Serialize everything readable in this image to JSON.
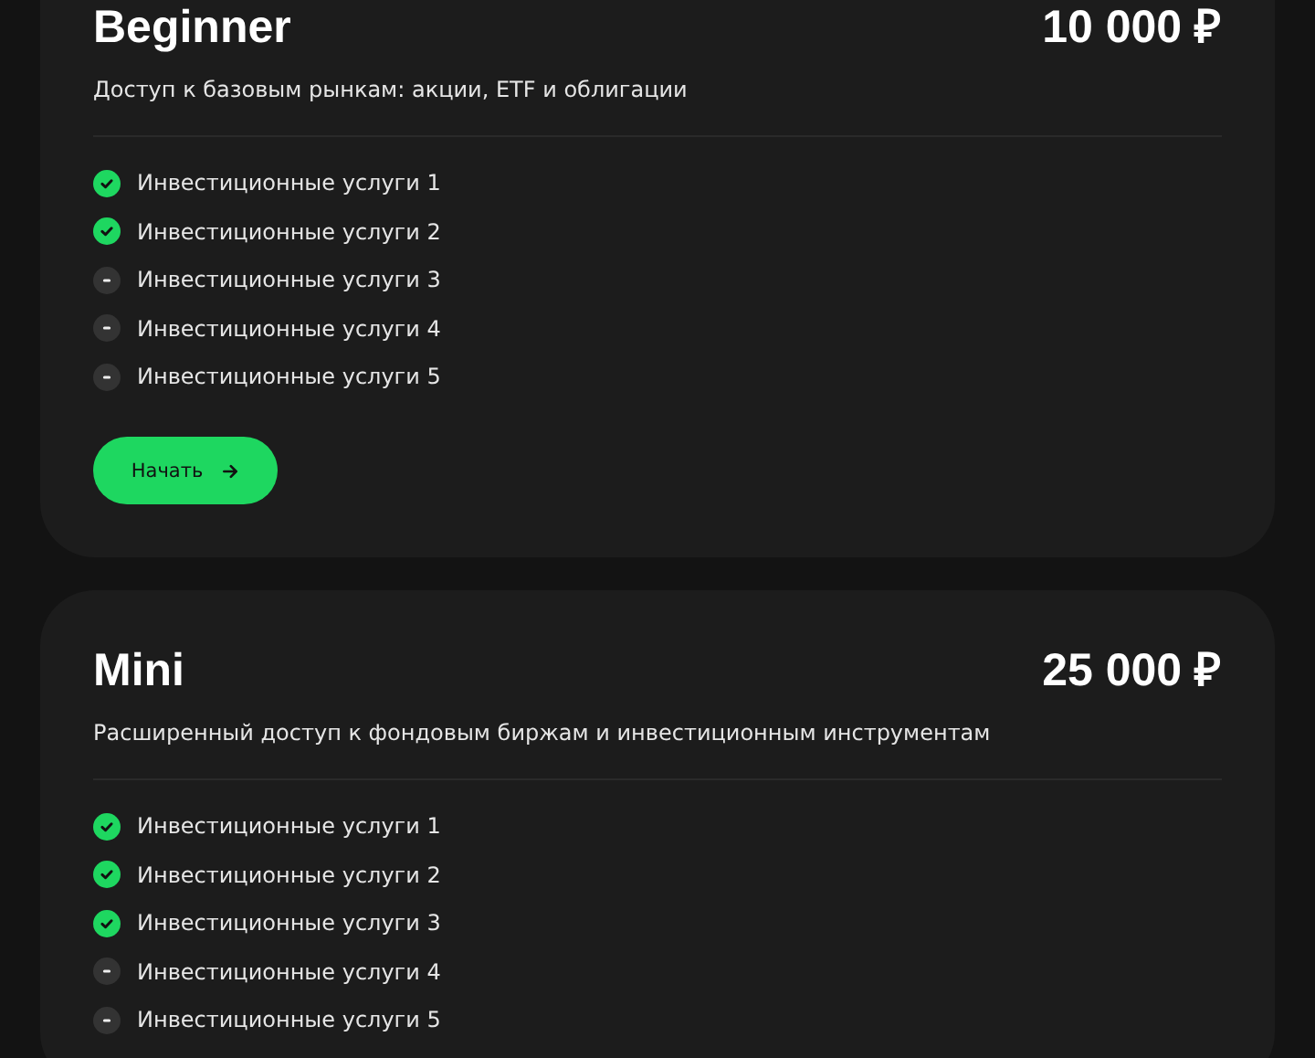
{
  "plans": [
    {
      "name": "Beginner",
      "price": "10 000 ₽",
      "description": "Доступ к базовым рынкам: акции, ETF и облигации",
      "features": [
        {
          "label": "Инвестиционные услуги 1",
          "included": true
        },
        {
          "label": "Инвестиционные услуги 2",
          "included": true
        },
        {
          "label": "Инвестиционные услуги 3",
          "included": false
        },
        {
          "label": "Инвестиционные услуги 4",
          "included": false
        },
        {
          "label": "Инвестиционные услуги 5",
          "included": false
        }
      ],
      "button": "Начать"
    },
    {
      "name": "Mini",
      "price": "25 000 ₽",
      "description": "Расширенный доступ к фондовым биржам и инвестиционным инструментам",
      "features": [
        {
          "label": "Инвестиционные услуги 1",
          "included": true
        },
        {
          "label": "Инвестиционные услуги 2",
          "included": true
        },
        {
          "label": "Инвестиционные услуги 3",
          "included": true
        },
        {
          "label": "Инвестиционные услуги 4",
          "included": false
        },
        {
          "label": "Инвестиционные услуги 5",
          "included": false
        }
      ]
    }
  ]
}
